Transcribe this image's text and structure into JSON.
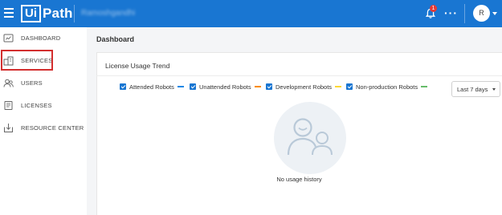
{
  "header": {
    "logo_box": "Ui",
    "logo_text": "Path",
    "tenant_name": "Ramoshgandhi",
    "notification_count": "1",
    "more_label": "···",
    "avatar_initial": "R"
  },
  "sidebar": {
    "items": [
      {
        "label": "DASHBOARD",
        "icon": "dashboard-icon"
      },
      {
        "label": "SERVICES",
        "icon": "services-icon",
        "highlighted": true
      },
      {
        "label": "USERS",
        "icon": "users-icon"
      },
      {
        "label": "LICENSES",
        "icon": "licenses-icon"
      },
      {
        "label": "RESOURCE CENTER",
        "icon": "resource-center-icon"
      }
    ]
  },
  "main": {
    "page_title": "Dashboard",
    "card": {
      "title": "License Usage Trend",
      "legend": [
        {
          "label": "Attended Robots",
          "checked": true,
          "color": "#1e88e5"
        },
        {
          "label": "Unattended Robots",
          "checked": true,
          "color": "#fb8c00"
        },
        {
          "label": "Development Robots",
          "checked": true,
          "color": "#fdd835"
        },
        {
          "label": "Non-production Robots",
          "checked": true,
          "color": "#66bb6a"
        }
      ],
      "period_select": {
        "value": "Last 7 days"
      },
      "empty_message": "No usage history"
    }
  },
  "colors": {
    "topbar": "#1976d2",
    "highlight": "#d32f2f",
    "checkbox": "#1976d2"
  }
}
